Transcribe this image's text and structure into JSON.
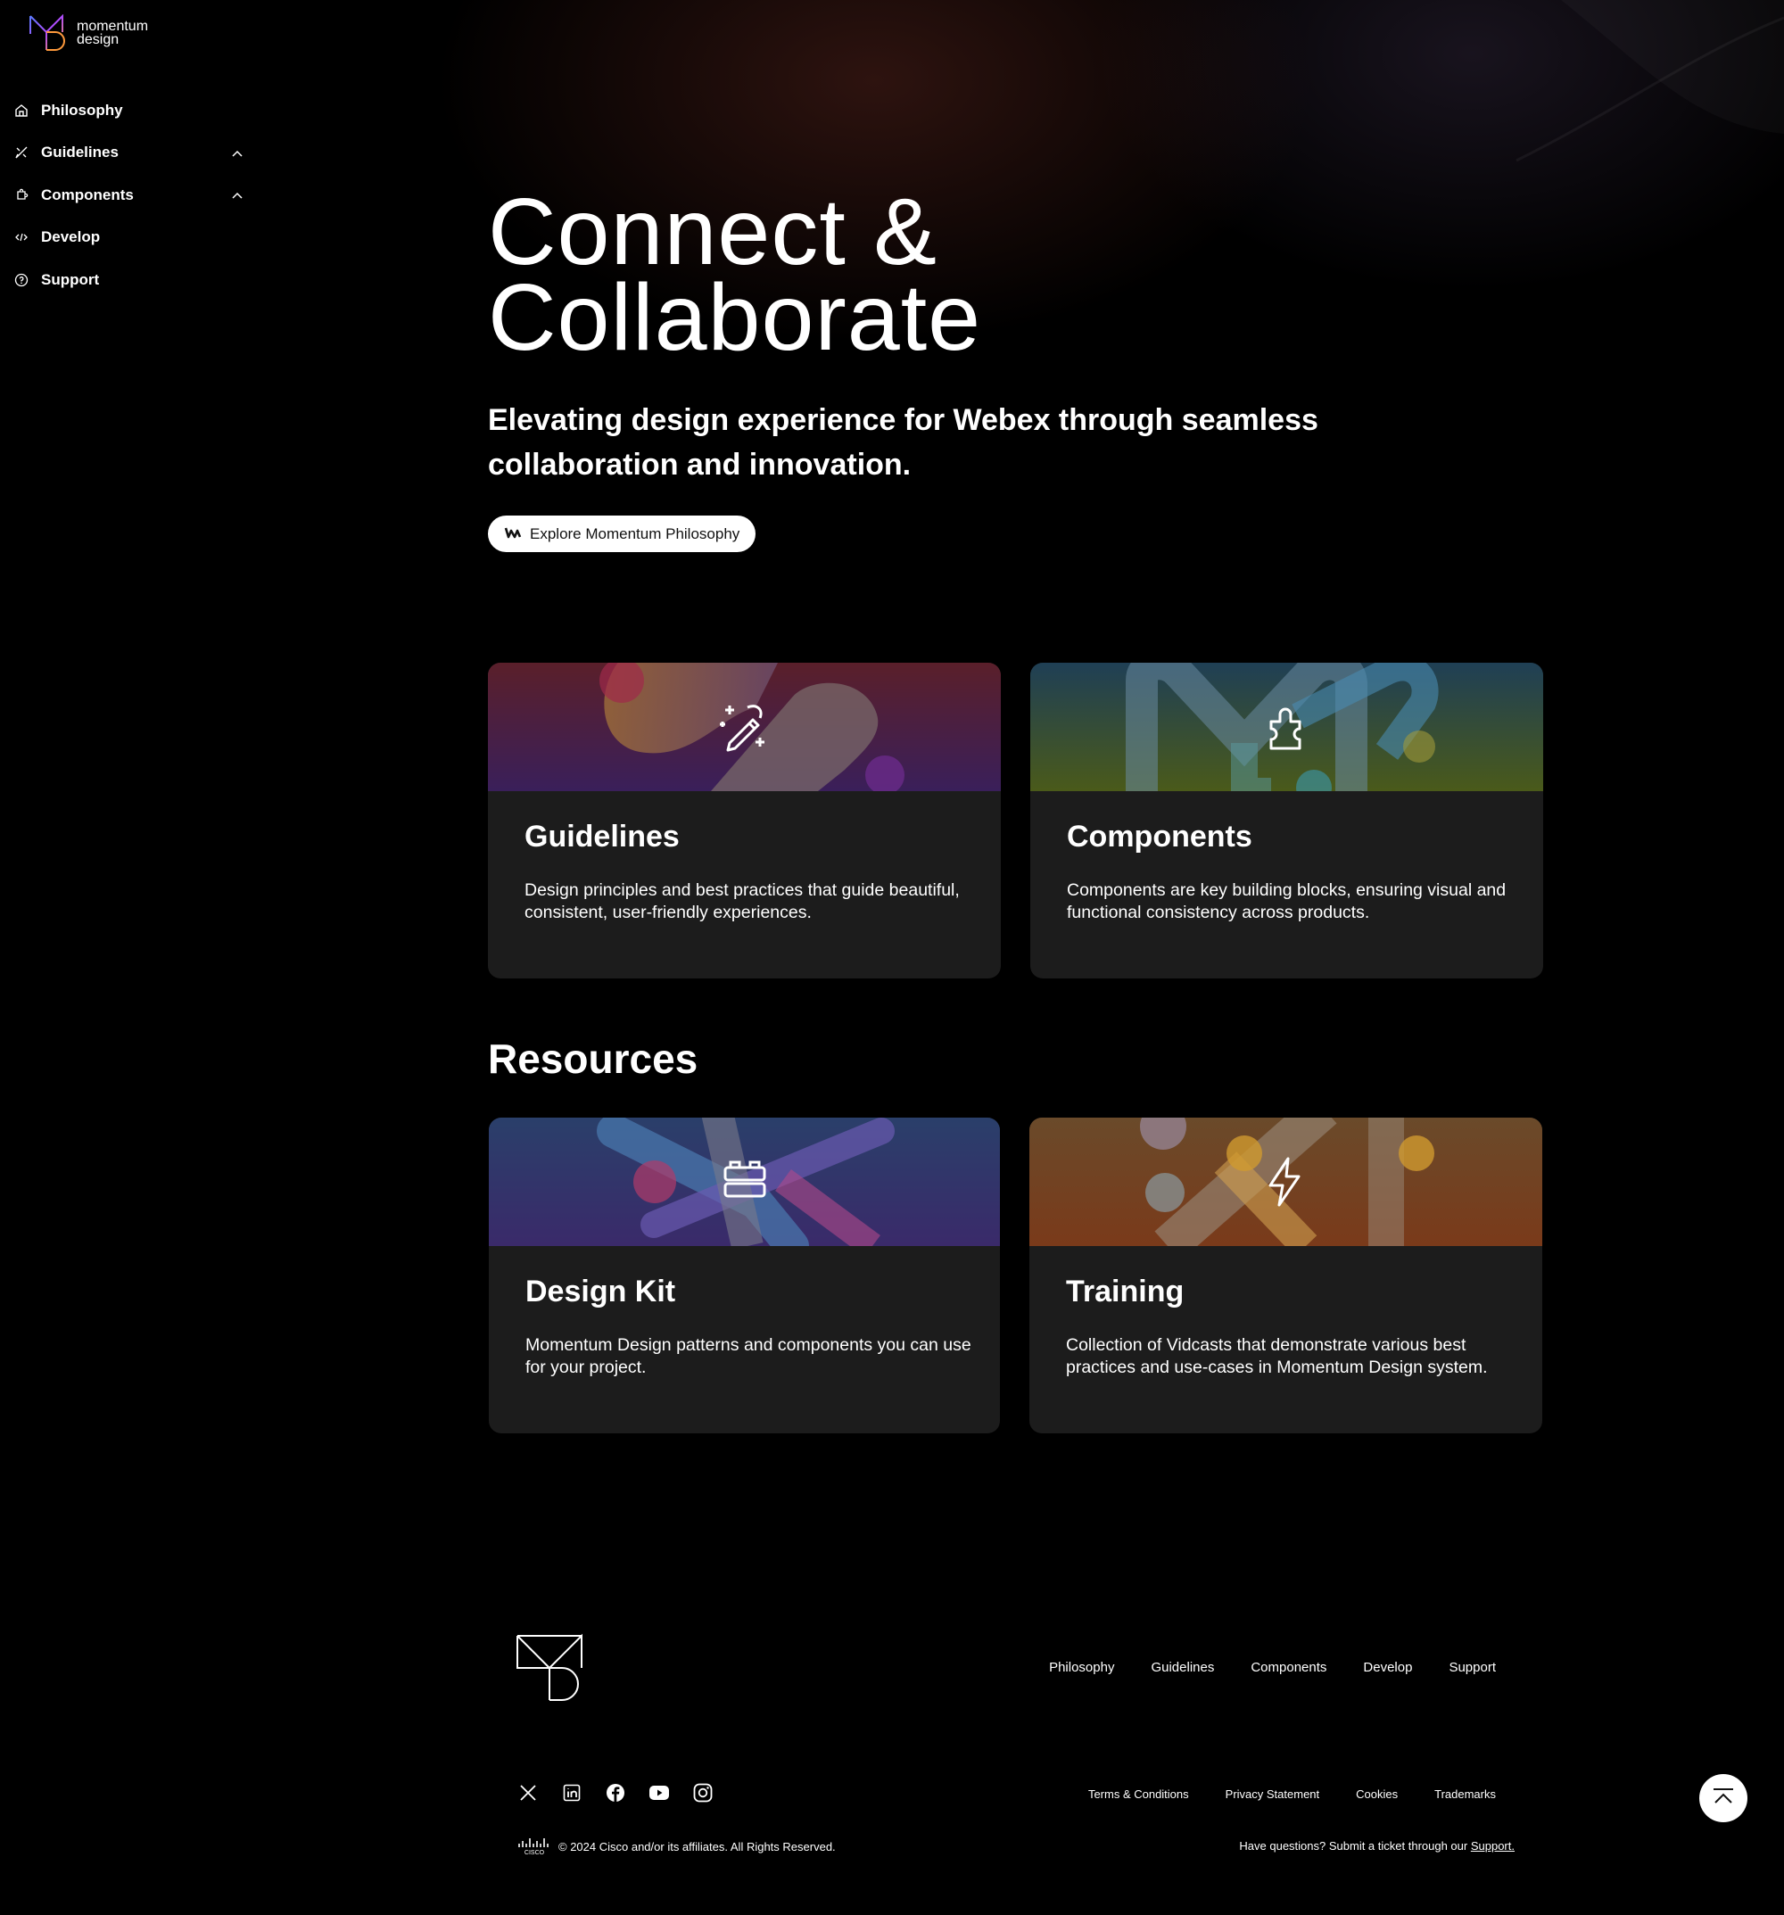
{
  "brand": {
    "logo_line1": "momentum",
    "logo_line2": "design"
  },
  "sidebar": {
    "items": [
      {
        "label": "Philosophy",
        "icon": "home-icon"
      },
      {
        "label": "Guidelines",
        "icon": "pencil-ruler-icon"
      },
      {
        "label": "Components",
        "icon": "puzzle-icon"
      },
      {
        "label": "Develop",
        "icon": "code-icon"
      },
      {
        "label": "Support",
        "icon": "help-circle-icon"
      }
    ]
  },
  "hero": {
    "title": "Connect &\nCollaborate",
    "subtitle": "Elevating design experience for Webex through seamless collaboration and innovation.",
    "cta_label": "Explore Momentum Philosophy"
  },
  "cards": [
    {
      "title": "Guidelines",
      "description": "Design principles and best practices that guide beautiful, consistent, user-friendly experiences.",
      "icon": "magic-wand-icon"
    },
    {
      "title": "Components",
      "description": "Components are key building blocks, ensuring visual and functional consistency across products.",
      "icon": "puzzle-icon"
    }
  ],
  "resources": {
    "title": "Resources",
    "cards": [
      {
        "title": "Design Kit",
        "description": "Momentum Design patterns and components you can use for your project.",
        "icon": "blocks-icon"
      },
      {
        "title": "Training",
        "description": "Collection of Vidcasts that demonstrate various best practices and use-cases in Momentum Design system.",
        "icon": "lightning-icon"
      }
    ]
  },
  "footer": {
    "nav": [
      "Philosophy",
      "Guidelines",
      "Components",
      "Develop",
      "Support"
    ],
    "social": [
      "x-icon",
      "linkedin-icon",
      "facebook-icon",
      "youtube-icon",
      "instagram-icon"
    ],
    "legal": [
      "Terms & Conditions",
      "Privacy Statement",
      "Cookies",
      "Trademarks"
    ],
    "copyright": "© 2024 Cisco and/or its affiliates. All Rights Reserved.",
    "support_note": "Have questions? Submit a ticket through our ",
    "support_link": "Support."
  },
  "colors": {
    "background": "#000000",
    "card": "#1c1c1c",
    "text": "#ffffff"
  }
}
